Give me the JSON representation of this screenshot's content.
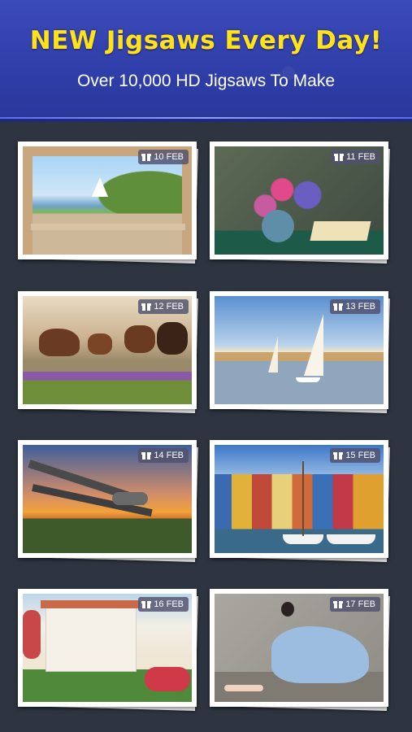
{
  "banner": {
    "headline": "NEW Jigsaws Every Day!",
    "subhead": "Over 10,000 HD Jigsaws To Make",
    "headline_color": "#ffe21a",
    "background_color": "#3141aa"
  },
  "puzzles": [
    {
      "date": "10 FEB",
      "icon": "gift-icon",
      "scene": "garden terrace with arches and sailboat"
    },
    {
      "date": "11 FEB",
      "icon": "gift-icon",
      "scene": "flowers in vase with open book"
    },
    {
      "date": "12 FEB",
      "icon": "gift-icon",
      "scene": "horses running in meadow"
    },
    {
      "date": "13 FEB",
      "icon": "gift-icon",
      "scene": "sailboats on lake at harbor"
    },
    {
      "date": "14 FEB",
      "icon": "gift-icon",
      "scene": "biplane over forest at sunset"
    },
    {
      "date": "15 FEB",
      "icon": "gift-icon",
      "scene": "colorful harbor houses with boats"
    },
    {
      "date": "16 FEB",
      "icon": "gift-icon",
      "scene": "white house with flower garden"
    },
    {
      "date": "17 FEB",
      "icon": "gift-icon",
      "scene": "ballerina sitting in blue dress"
    }
  ]
}
